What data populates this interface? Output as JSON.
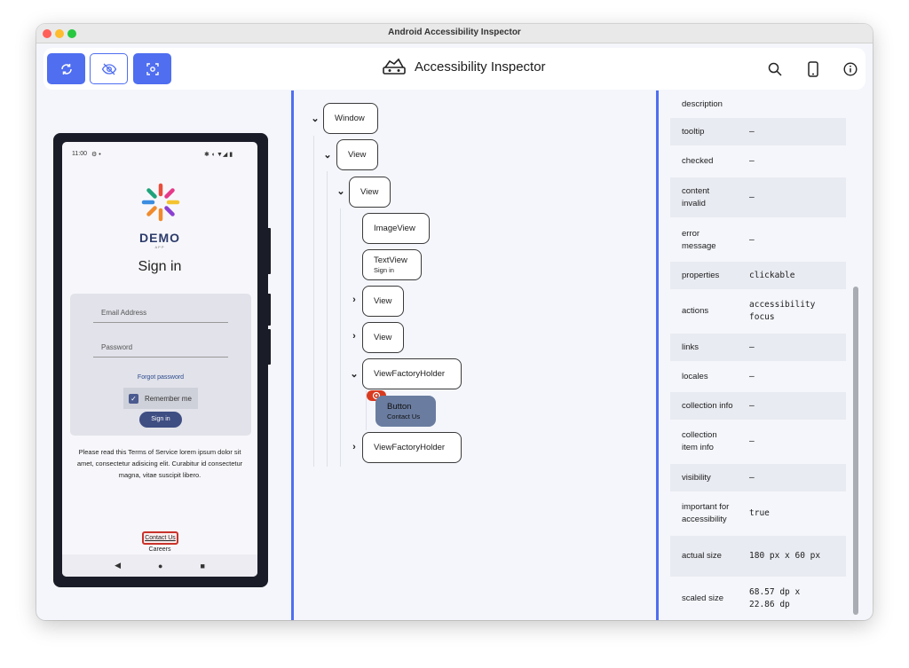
{
  "window": {
    "title": "Android Accessibility Inspector",
    "traffic_colors": [
      "#ff5f57",
      "#febc2e",
      "#28c840"
    ]
  },
  "toolbar": {
    "buttons": [
      {
        "icon": "refresh-icon",
        "style": "filled"
      },
      {
        "icon": "eye-off-icon",
        "style": "outline"
      },
      {
        "icon": "screenshot-icon",
        "style": "filled"
      }
    ],
    "app_title": "Accessibility Inspector",
    "right_icons": [
      "search-icon",
      "phone-icon",
      "info-icon"
    ],
    "accent": "#4f6ef0"
  },
  "device": {
    "status_time": "11:00",
    "demo_label": "DEMO",
    "app_label": "APP",
    "signin_title": "Sign in",
    "email_placeholder": "Email Address",
    "password_placeholder": "Password",
    "forgot_password": "Forgot password",
    "remember_me": "Remember me",
    "signin_button": "Sign in",
    "tos_text": "Please read this Terms of Service lorem ipsum dolor sit amet, consectetur adisicing elit. Curabitur id consectetur magna, vitae suscipit libero.",
    "contact_link": "Contact Us",
    "careers_link": "Careers",
    "nav_icons": [
      "back-icon",
      "home-icon",
      "recents-icon"
    ]
  },
  "tree": {
    "nodes": [
      {
        "label": "Window",
        "expanded": true
      },
      {
        "label": "View",
        "expanded": true
      },
      {
        "label": "View",
        "expanded": true
      },
      {
        "label": "ImageView"
      },
      {
        "label": "TextView",
        "sub": "Sign in"
      },
      {
        "label": "View",
        "expanded": false
      },
      {
        "label": "View",
        "expanded": false
      },
      {
        "label": "ViewFactoryHolder",
        "expanded": true
      },
      {
        "label": "Button",
        "sub": "Contact Us",
        "selected": true
      },
      {
        "label": "ViewFactoryHolder",
        "expanded": false
      }
    ]
  },
  "properties": {
    "rows": [
      {
        "key": "description",
        "value": ""
      },
      {
        "key": "tooltip",
        "value": "–"
      },
      {
        "key": "checked",
        "value": "–"
      },
      {
        "key": "content invalid",
        "value": "–"
      },
      {
        "key": "error message",
        "value": "–"
      },
      {
        "key": "properties",
        "value": "clickable"
      },
      {
        "key": "actions",
        "value": "accessibility focus"
      },
      {
        "key": "links",
        "value": "–"
      },
      {
        "key": "locales",
        "value": "–"
      },
      {
        "key": "collection info",
        "value": "–"
      },
      {
        "key": "collection item info",
        "value": "–"
      },
      {
        "key": "visibility",
        "value": "–"
      },
      {
        "key": "important for accessibility",
        "value": "true"
      },
      {
        "key": "actual size",
        "value": "180 px x 60 px"
      },
      {
        "key": "scaled size",
        "value": "68.57 dp x 22.86 dp"
      }
    ]
  }
}
